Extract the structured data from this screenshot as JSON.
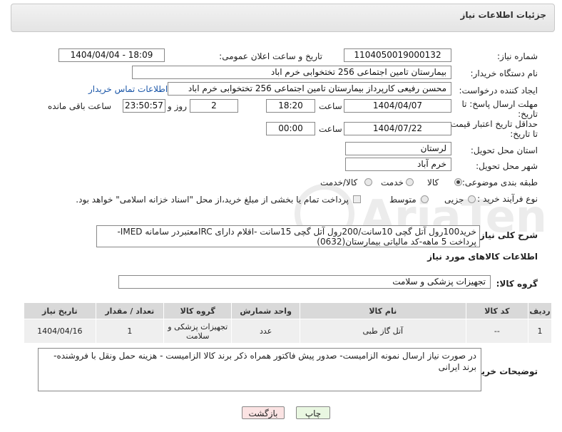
{
  "header": {
    "title": "جزئیات اطلاعات نیاز"
  },
  "fields": {
    "need_number_label": "شماره نیاز:",
    "need_number": "1104050019000132",
    "announce_label": "تاریخ و ساعت اعلان عمومی:",
    "announce_value": "1404/04/04 - 18:09",
    "buyer_org_label": "نام دستگاه خریدار:",
    "buyer_org": "بیمارستان تامین اجتماعی  256 تختخوابی خرم اباد",
    "creator_label": "ایجاد کننده درخواست:",
    "creator": "محسن رفیعی کارپرداز بیمارستان تامین اجتماعی  256 تختخوابی خرم اباد",
    "contact_link": "اطلاعات تماس خریدار",
    "deadline_label_1": "مهلت ارسال پاسخ: تا",
    "deadline_label_2": "تاریخ:",
    "deadline_date": "1404/04/07",
    "time_label": "ساعت",
    "deadline_time": "18:20",
    "days_value": "2",
    "days_label": "روز و",
    "remaining_time": "23:50:57",
    "remaining_label": "ساعت باقی مانده",
    "validity_label_1": "حداقل تاریخ اعتبار قیمت:",
    "validity_label_2": "تا تاریخ:",
    "validity_date": "1404/07/22",
    "validity_time": "00:00",
    "province_label": "استان محل تحویل:",
    "province": "لرستان",
    "city_label": "شهر محل تحویل:",
    "city": "خرم آباد",
    "category_label": "طبقه بندی موضوعی:",
    "category_options": [
      "کالا",
      "خدمت",
      "کالا/خدمت"
    ],
    "process_label": "نوع فرآیند خرید :",
    "process_options": [
      "جزیی",
      "متوسط"
    ],
    "treasury_text": "پرداخت تمام یا بخشی از مبلغ خرید،از محل \"اسناد خزانه اسلامی\" خواهد بود."
  },
  "description": {
    "label": "شرح کلی نیاز:",
    "text": "خرید100رول آتل گچی 10سانت/200رول آتل گچی 15سانت -اقلام دارای IRCمعتبردر سامانه IMED-پرداخت 5 ماهه-کد مالیاتی بیمارستان(0632)"
  },
  "goods_section": {
    "title": "اطلاعات کالاهای مورد نیاز",
    "group_label": "گروه کالا:",
    "group_value": "تجهیزات پزشکی و سلامت"
  },
  "table": {
    "headers": [
      "ردیف",
      "کد کالا",
      "نام کالا",
      "واحد شمارش",
      "گروه کالا",
      "تعداد / مقدار",
      "تاریخ نیاز"
    ],
    "rows": [
      [
        "1",
        "--",
        "آتل گاز طبی",
        "عدد",
        "تجهیزات پزشکی و سلامت",
        "1",
        "1404/04/16"
      ]
    ]
  },
  "buyer_notes": {
    "label": "توضیحات خریدار:",
    "text": "در صورت نیاز ارسال نمونه الزامیست- صدور پیش فاکتور همراه ذکر برند کالا  الزامیست - هزینه حمل ونقل با فروشنده-برند ایرانی"
  },
  "buttons": {
    "print": "چاپ",
    "back": "بازگشت"
  },
  "colors": {
    "link": "#1a56a8",
    "back_button": "#fbe3e3",
    "print_button": "#e9f7e1"
  }
}
